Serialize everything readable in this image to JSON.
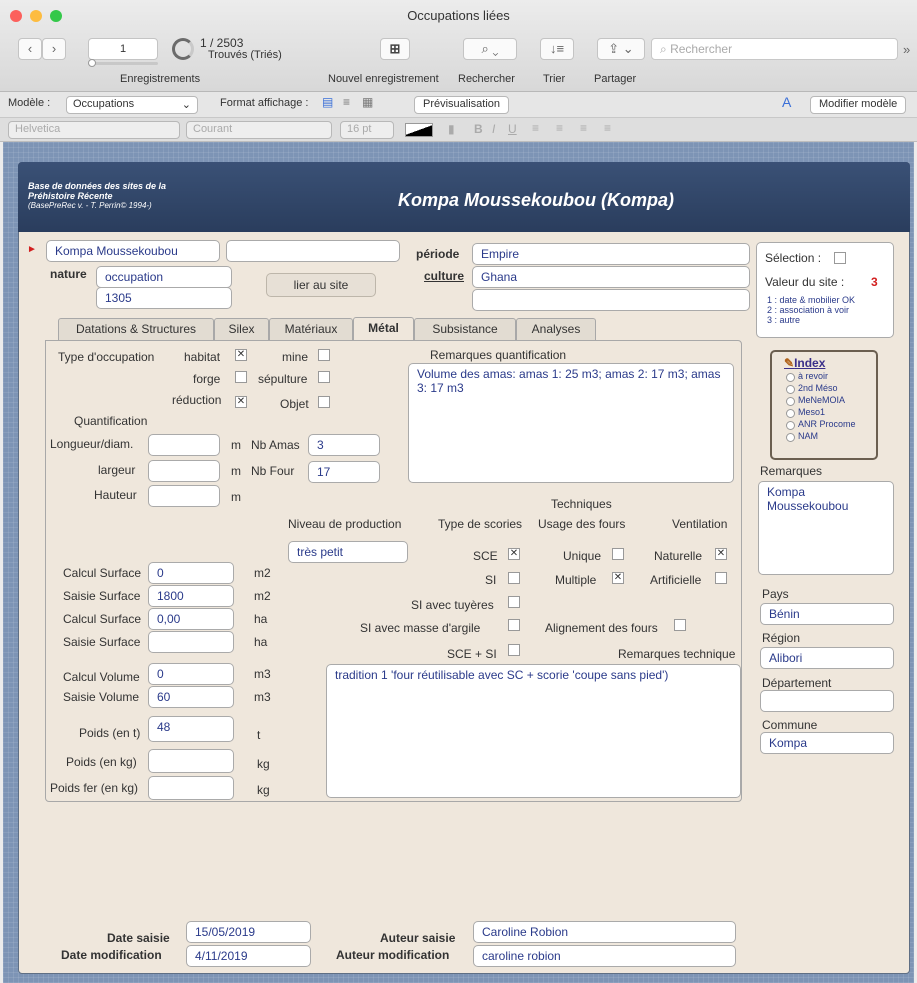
{
  "window": {
    "title": "Occupations liées"
  },
  "toolbar": {
    "record_value": "1",
    "record_count": "1 / 2503",
    "record_sub": "Trouvés (Triés)",
    "records_label": "Enregistrements",
    "new_record_label": "Nouvel enregistrement",
    "search_label": "Rechercher",
    "sort_label": "Trier",
    "share_label": "Partager",
    "search_placeholder": "Rechercher"
  },
  "layoutbar": {
    "model_label": "Modèle :",
    "model_value": "Occupations",
    "format_label": "Format affichage :",
    "preview_label": "Prévisualisation",
    "modify_label": "Modifier modèle"
  },
  "formatbar": {
    "font": "Helvetica",
    "style": "Courant",
    "size": "16 pt"
  },
  "banner": {
    "db_title_1": "Base de données des sites de la",
    "db_title_2": "Préhistoire Récente",
    "db_credit": "(BasePreRec v. - T. Perrin© 1994-)",
    "site_title": "Kompa Moussekoubou  (Kompa)"
  },
  "header": {
    "site_name": "Kompa Moussekoubou",
    "nature_label": "nature",
    "nature_value": "occupation",
    "nature_code": "1305",
    "link_button": "lier au site",
    "periode_label": "période",
    "periode_value": "Empire",
    "culture_label": "culture",
    "culture_value": "Ghana"
  },
  "selection": {
    "label": "Sélection :",
    "value_label": "Valeur du site :",
    "value": "3",
    "legend_1": "1 : date & mobilier OK",
    "legend_2": "2 : association à voir",
    "legend_3": "3 : autre"
  },
  "index": {
    "title": "Index",
    "options": [
      "à revoir",
      "2nd Méso",
      "MeNeMOIA",
      "Meso1",
      "ANR Procome",
      "NAM"
    ]
  },
  "side": {
    "remarques_label": "Remarques",
    "remarques_value": "Kompa Moussekoubou",
    "pays_label": "Pays",
    "pays_value": "Bénin",
    "region_label": "Région",
    "region_value": "Alibori",
    "departement_label": "Département",
    "departement_value": "",
    "commune_label": "Commune",
    "commune_value": "Kompa"
  },
  "tabs": [
    "Datations & Structures",
    "Silex",
    "Matériaux",
    "Métal",
    "Subsistance",
    "Analyses"
  ],
  "metal": {
    "type_occupation_label": "Type d'occupation",
    "habitat": "habitat",
    "forge": "forge",
    "reduction": "réduction",
    "mine": "mine",
    "sepulture": "sépulture",
    "objet": "Objet",
    "quantification_label": "Quantification",
    "longueur_label": "Longueur/diam.",
    "largeur_label": "largeur",
    "hauteur_label": "Hauteur",
    "unit_m": "m",
    "nb_amas_label": "Nb Amas",
    "nb_amas_value": "3",
    "nb_four_label": "Nb Four",
    "nb_four_value": "17",
    "remarques_quant_label": "Remarques quantification",
    "remarques_quant_value": "Volume des amas: amas 1: 25 m3; amas 2: 17 m3; amas 3: 17 m3",
    "techniques_label": "Techniques",
    "niveau_label": "Niveau de production",
    "niveau_value": "très petit",
    "type_scories_label": "Type de scories",
    "usage_fours_label": "Usage des fours",
    "ventilation_label": "Ventilation",
    "sce": "SCE",
    "si": "SI",
    "si_tuyeres": "SI avec tuyères",
    "si_argile": "SI avec masse d'argile",
    "sce_si": "SCE + SI",
    "unique": "Unique",
    "multiple": "Multiple",
    "alignement": "Alignement des fours",
    "naturelle": "Naturelle",
    "artificielle": "Artificielle",
    "remarques_tech_label": "Remarques technique",
    "remarques_tech_value": "tradition 1 'four réutilisable avec SC + scorie 'coupe sans pied')",
    "calc_surface_label": "Calcul Surface",
    "calc_surface_m2": "0",
    "unit_m2": "m2",
    "saisie_surface_label": "Saisie Surface",
    "saisie_surface_m2": "1800",
    "calc_surface_ha": "0,00",
    "unit_ha": "ha",
    "saisie_surface_ha": "",
    "calc_volume_label": "Calcul Volume",
    "calc_volume": "0",
    "unit_m3": "m3",
    "saisie_volume_label": "Saisie Volume",
    "saisie_volume": "60",
    "poids_t_label": "Poids (en t)",
    "poids_t": "48",
    "unit_t": "t",
    "poids_kg_label": "Poids (en kg)",
    "unit_kg": "kg",
    "poids_fer_label": "Poids fer (en kg)"
  },
  "footer": {
    "date_saisie_label": "Date saisie",
    "date_saisie": "15/05/2019",
    "date_modif_label": "Date modification",
    "date_modif": "4/11/2019",
    "auteur_saisie_label": "Auteur saisie",
    "auteur_saisie": "Caroline Robion",
    "auteur_modif_label": "Auteur modification",
    "auteur_modif": "caroline robion"
  }
}
